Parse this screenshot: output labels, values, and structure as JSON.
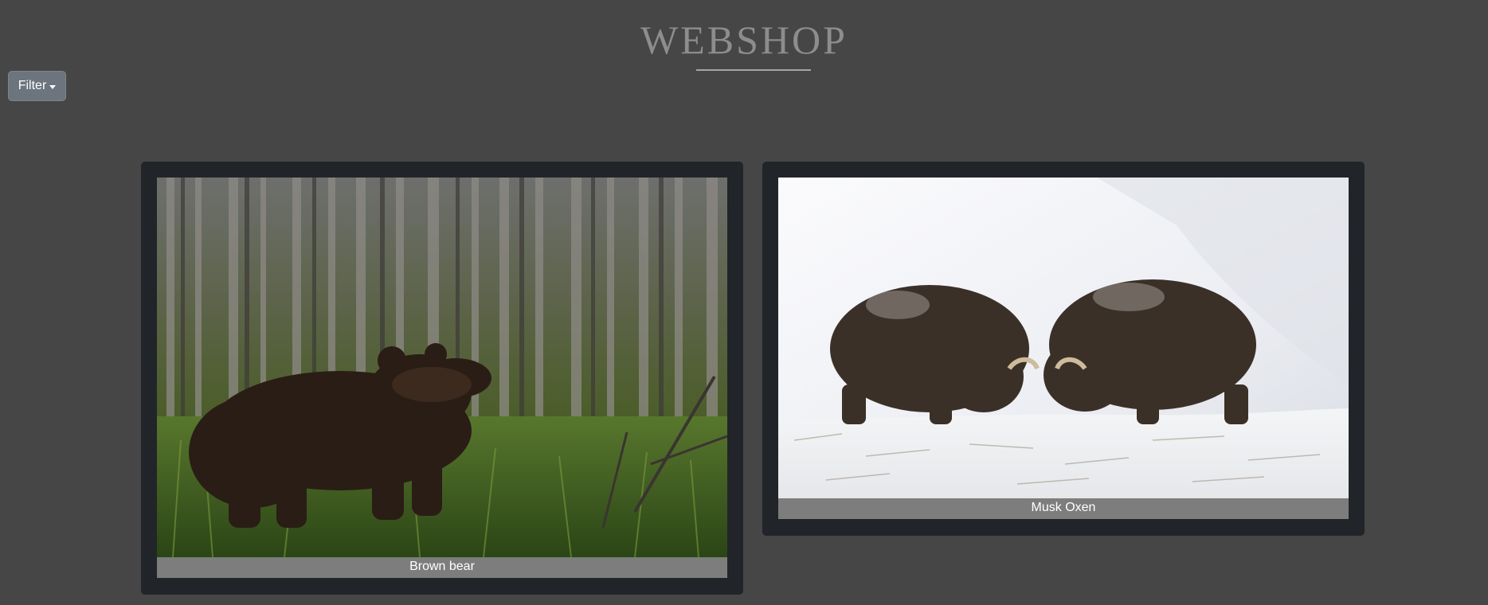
{
  "header": {
    "title": "WEBSHOP"
  },
  "toolbar": {
    "filter_label": "Filter",
    "filter_icon": "chevron-down-icon"
  },
  "products": [
    {
      "caption": "Brown bear",
      "image": "brown-bear-photo"
    },
    {
      "caption": "Musk Oxen",
      "image": "musk-oxen-photo"
    }
  ],
  "colors": {
    "background": "#464646",
    "card": "#212529",
    "caption_bar": "#7d7d7d",
    "button": "#6c757d",
    "title": "#8d8d8d"
  }
}
